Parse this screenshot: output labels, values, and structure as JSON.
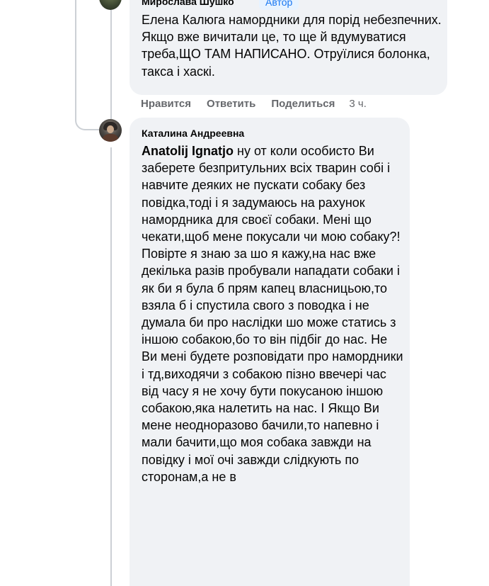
{
  "top_comment": {
    "author": "Мирослава Шушко",
    "badge": "Автор",
    "text": "Елена Калюга намордники для порід небезпечних. Якщо вже вичитали це, то ще й вдумуватися треба,ЩО ТАМ НАПИСАНО. Отруїлися болонка, такса і хаскі.",
    "actions": {
      "like": "Нравится",
      "reply": "Ответить",
      "share": "Поделиться",
      "time": "3 ч."
    }
  },
  "reply_comment": {
    "author": "Каталина Андреевна",
    "mention": "Anatolij Ignatjo",
    "text": " ну от коли особисто Ви заберете безпритульних всіх тварин собі і навчите деяких не пускати собаку без повідка,тоді і я задумаюсь на рахунок намордника для своєї собаки. Мені що чекати,щоб мене покусали чи мою собаку?! Повірте я знаю за шо я кажу,на нас вже декілька разів пробували нападати собаки і як би я була б прям капец власницьою,то взяла б і спустила свого з поводка і не думала би про наслідки шо може статись з іншою собакою,бо то він підбіг до нас. Не Ви мені будете розповідати про намордники і тд,виходячи з собакою пізно ввечері час від часу я не хочу бути покусаною іншою собакою,яка налетить на нас. І Якщо Ви мене неодноразово бачили,то напевно і мали бачити,що моя собака завжди на повідку і мої очі завжди слідкують по сторонам,а не в"
  }
}
